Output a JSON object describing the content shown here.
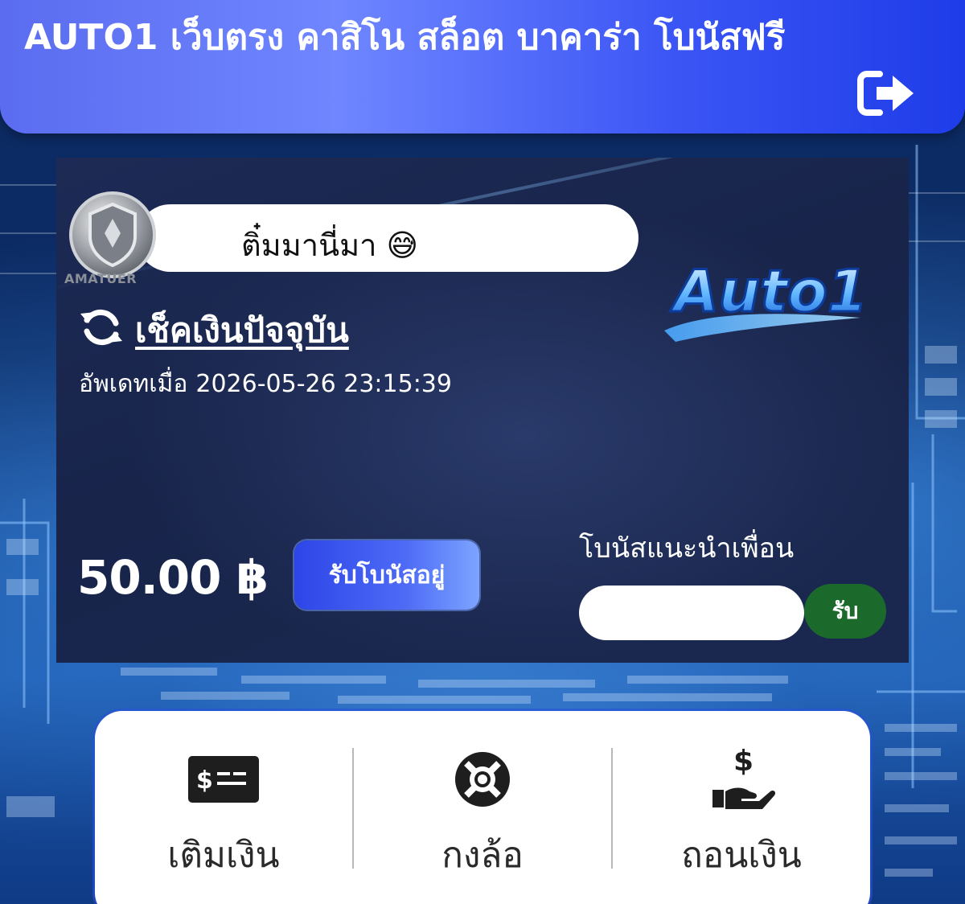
{
  "header": {
    "title": "AUTO1 เว็บตรง คาสิโน สล็อต บาคาร่า โบนัสฟรี"
  },
  "user": {
    "rank_label": "AMATUER",
    "display_name": "ติ๋มมานี่มา 😅"
  },
  "balance": {
    "check_label": "เช็คเงินปัจจุบัน",
    "updated_prefix": "อัพเดทเมื่อ",
    "updated_at": "2026-05-26 23:15:39",
    "amount": "50.00 ฿",
    "bonus_button": "รับโบนัสอยู่"
  },
  "brand": {
    "logo_text": "Auto1"
  },
  "referral": {
    "label": "โบนัสแนะนำเพื่อน",
    "input_value": "",
    "submit_label": "รับ"
  },
  "actions": [
    {
      "label": "เติมเงิน",
      "icon": "deposit-icon"
    },
    {
      "label": "กงล้อ",
      "icon": "lifebuoy-wheel-icon"
    },
    {
      "label": "ถอนเงิน",
      "icon": "withdraw-hand-dollar-icon"
    }
  ],
  "colors": {
    "header_gradient_start": "#5b6cf0",
    "header_gradient_end": "#1e3ce8",
    "bonus_button": "#4d6bf6",
    "referral_button": "#1b6a2c",
    "card_background": "#1c2a55"
  }
}
